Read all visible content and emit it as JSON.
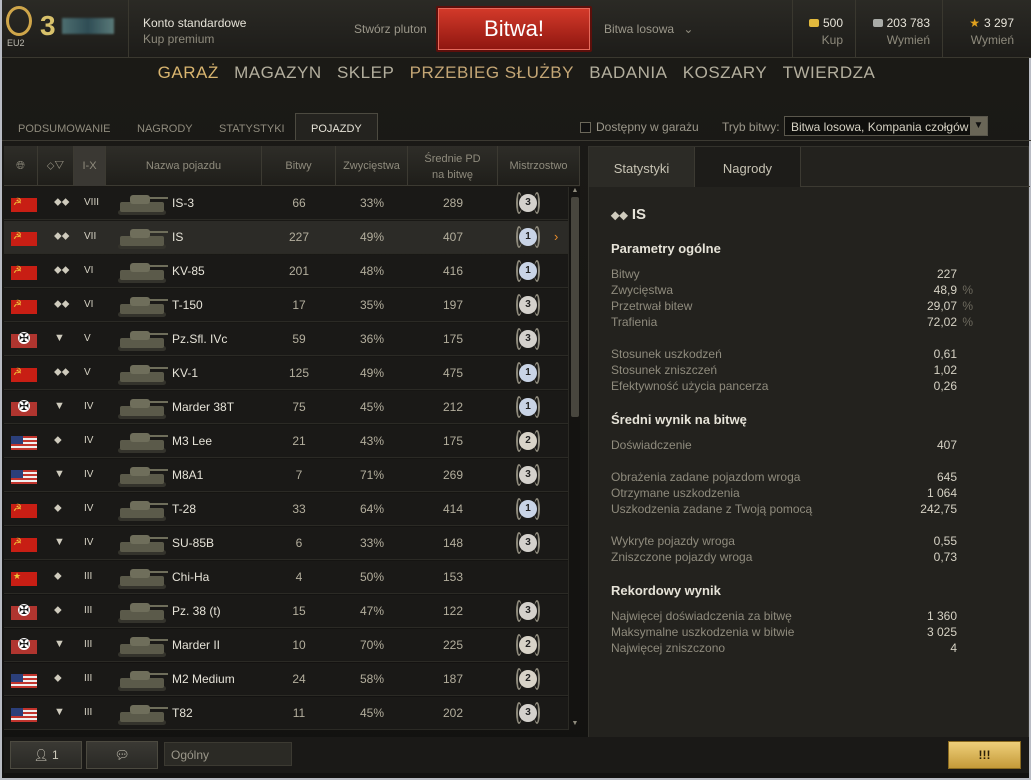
{
  "topbar": {
    "logo_text": "EU2",
    "player_number": "3",
    "account_type": "Konto standardowe",
    "buy_premium": "Kup premium",
    "create_platoon": "Stwórz pluton",
    "battle_button": "Bitwa!",
    "battle_mode": "Bitwa losowa",
    "gold_value": "500",
    "gold_action": "Kup",
    "credits_value": "203 783",
    "credits_action": "Wymień",
    "xp_value": "3 297",
    "xp_action": "Wymień"
  },
  "main_menu": [
    "GARAŻ",
    "MAGAZYN",
    "SKLEP",
    "PRZEBIEG SŁUŻBY",
    "BADANIA",
    "KOSZARY",
    "TWIERDZA"
  ],
  "sub_tabs": [
    "PODSUMOWANIE",
    "NAGRODY",
    "STATYSTYKI",
    "POJAZDY"
  ],
  "filters": {
    "available_label": "Dostępny w garażu",
    "mode_label": "Tryb bitwy:",
    "mode_value": "Bitwa losowa, Kompania czołgów"
  },
  "table": {
    "headers": {
      "tier": "I-X",
      "name": "Nazwa pojazdu",
      "battles": "Bitwy",
      "wins": "Zwycięstwa",
      "avg_dmg": "Średnie PD na bitwę",
      "mastery": "Mistrzostwo"
    },
    "rows": [
      {
        "nation": "ussr",
        "class": "⬥⬥",
        "tier": "VIII",
        "name": "IS-3",
        "battles": "66",
        "wins": "33%",
        "avg": "289",
        "mastery": "3"
      },
      {
        "nation": "ussr",
        "class": "⬥⬥",
        "tier": "VII",
        "name": "IS",
        "battles": "227",
        "wins": "49%",
        "avg": "407",
        "mastery": "1"
      },
      {
        "nation": "ussr",
        "class": "⬥⬥",
        "tier": "VI",
        "name": "KV-85",
        "battles": "201",
        "wins": "48%",
        "avg": "416",
        "mastery": "1"
      },
      {
        "nation": "ussr",
        "class": "⬥⬥",
        "tier": "VI",
        "name": "T-150",
        "battles": "17",
        "wins": "35%",
        "avg": "197",
        "mastery": "3"
      },
      {
        "nation": "ger",
        "class": "▼",
        "tier": "V",
        "name": "Pz.Sfl. IVc",
        "battles": "59",
        "wins": "36%",
        "avg": "175",
        "mastery": "3"
      },
      {
        "nation": "ussr",
        "class": "⬥⬥",
        "tier": "V",
        "name": "KV-1",
        "battles": "125",
        "wins": "49%",
        "avg": "475",
        "mastery": "1"
      },
      {
        "nation": "ger",
        "class": "▼",
        "tier": "IV",
        "name": "Marder 38T",
        "battles": "75",
        "wins": "45%",
        "avg": "212",
        "mastery": "1"
      },
      {
        "nation": "usa",
        "class": "⬥",
        "tier": "IV",
        "name": "M3 Lee",
        "battles": "21",
        "wins": "43%",
        "avg": "175",
        "mastery": "2"
      },
      {
        "nation": "usa",
        "class": "▼",
        "tier": "IV",
        "name": "M8A1",
        "battles": "7",
        "wins": "71%",
        "avg": "269",
        "mastery": "3"
      },
      {
        "nation": "ussr",
        "class": "⬥",
        "tier": "IV",
        "name": "T-28",
        "battles": "33",
        "wins": "64%",
        "avg": "414",
        "mastery": "1"
      },
      {
        "nation": "ussr",
        "class": "▼",
        "tier": "IV",
        "name": "SU-85B",
        "battles": "6",
        "wins": "33%",
        "avg": "148",
        "mastery": "3"
      },
      {
        "nation": "chn",
        "class": "⬥",
        "tier": "III",
        "name": "Chi-Ha",
        "battles": "4",
        "wins": "50%",
        "avg": "153",
        "mastery": ""
      },
      {
        "nation": "ger",
        "class": "⬥",
        "tier": "III",
        "name": "Pz. 38 (t)",
        "battles": "15",
        "wins": "47%",
        "avg": "122",
        "mastery": "3"
      },
      {
        "nation": "ger",
        "class": "▼",
        "tier": "III",
        "name": "Marder II",
        "battles": "10",
        "wins": "70%",
        "avg": "225",
        "mastery": "2"
      },
      {
        "nation": "usa",
        "class": "⬥",
        "tier": "III",
        "name": "M2 Medium",
        "battles": "24",
        "wins": "58%",
        "avg": "187",
        "mastery": "2"
      },
      {
        "nation": "usa",
        "class": "▼",
        "tier": "III",
        "name": "T82",
        "battles": "11",
        "wins": "45%",
        "avg": "202",
        "mastery": "3"
      }
    ]
  },
  "right_panel": {
    "tabs": [
      "Statystyki",
      "Nagrody"
    ],
    "vehicle": "IS",
    "general_title": "Parametry ogólne",
    "general": [
      {
        "label": "Bitwy",
        "value": "227",
        "unit": ""
      },
      {
        "label": "Zwycięstwa",
        "value": "48,9",
        "unit": "%"
      },
      {
        "label": "Przetrwał bitew",
        "value": "29,07",
        "unit": "%"
      },
      {
        "label": "Trafienia",
        "value": "72,02",
        "unit": "%"
      }
    ],
    "ratios": [
      {
        "label": "Stosunek uszkodzeń",
        "value": "0,61"
      },
      {
        "label": "Stosunek zniszczeń",
        "value": "1,02"
      },
      {
        "label": "Efektywność użycia pancerza",
        "value": "0,26"
      }
    ],
    "avg_title": "Średni wynik na bitwę",
    "avg_xp": {
      "label": "Doświadczenie",
      "value": "407"
    },
    "avg_dmg": [
      {
        "label": "Obrażenia zadane pojazdom wroga",
        "value": "645"
      },
      {
        "label": "Otrzymane uszkodzenia",
        "value": "1 064"
      },
      {
        "label": "Uszkodzenia zadane z Twoją pomocą",
        "value": "242,75"
      }
    ],
    "avg_spot": [
      {
        "label": "Wykryte pojazdy wroga",
        "value": "0,55"
      },
      {
        "label": "Zniszczone pojazdy wroga",
        "value": "0,73"
      }
    ],
    "record_title": "Rekordowy wynik",
    "records": [
      {
        "label": "Najwięcej doświadczenia za bitwę",
        "value": "1 360"
      },
      {
        "label": "Maksymalne uszkodzenia w bitwie",
        "value": "3 025"
      },
      {
        "label": "Najwięcej zniszczono",
        "value": "4"
      }
    ]
  },
  "bottom": {
    "friends_count": "1",
    "chat_channel": "Ogólny"
  }
}
